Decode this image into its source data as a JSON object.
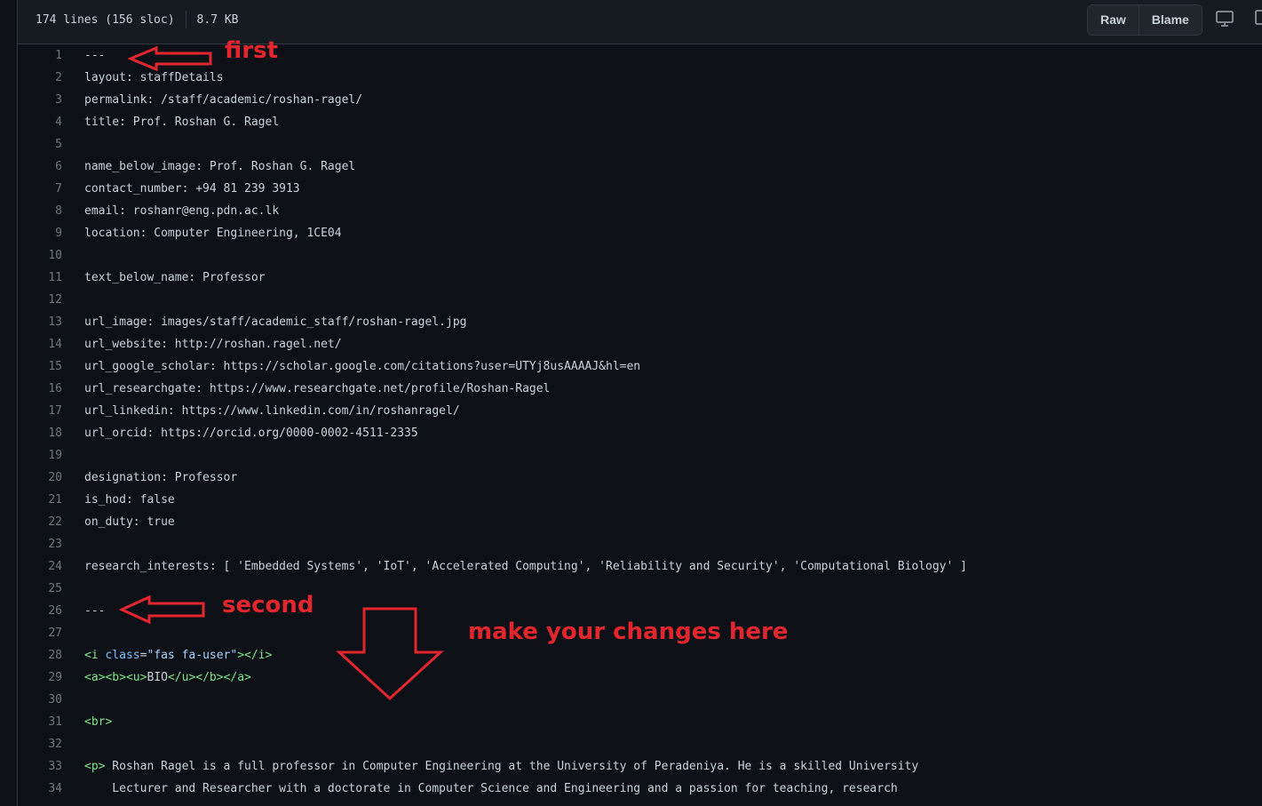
{
  "header": {
    "lines_info": "174 lines (156 sloc)",
    "size_info": "8.7 KB",
    "raw_label": "Raw",
    "blame_label": "Blame",
    "display_icon": "monitor-icon",
    "copy_icon": "copy-icon"
  },
  "colors": {
    "annotation": "#e3262d",
    "background": "#0d1117",
    "text": "#c9d1d9"
  },
  "code": {
    "lines": [
      {
        "n": "1",
        "t": "---"
      },
      {
        "n": "2",
        "t": "layout: staffDetails"
      },
      {
        "n": "3",
        "t": "permalink: /staff/academic/roshan-ragel/"
      },
      {
        "n": "4",
        "t": "title: Prof. Roshan G. Ragel"
      },
      {
        "n": "5",
        "t": ""
      },
      {
        "n": "6",
        "t": "name_below_image: Prof. Roshan G. Ragel"
      },
      {
        "n": "7",
        "t": "contact_number: +94 81 239 3913"
      },
      {
        "n": "8",
        "t": "email: roshanr@eng.pdn.ac.lk"
      },
      {
        "n": "9",
        "t": "location: Computer Engineering, 1CE04"
      },
      {
        "n": "10",
        "t": ""
      },
      {
        "n": "11",
        "t": "text_below_name: Professor"
      },
      {
        "n": "12",
        "t": ""
      },
      {
        "n": "13",
        "t": "url_image: images/staff/academic_staff/roshan-ragel.jpg"
      },
      {
        "n": "14",
        "t": "url_website: http://roshan.ragel.net/"
      },
      {
        "n": "15",
        "t": "url_google_scholar: https://scholar.google.com/citations?user=UTYj8usAAAAJ&hl=en"
      },
      {
        "n": "16",
        "t": "url_researchgate: https://www.researchgate.net/profile/Roshan-Ragel"
      },
      {
        "n": "17",
        "t": "url_linkedin: https://www.linkedin.com/in/roshanragel/"
      },
      {
        "n": "18",
        "t": "url_orcid: https://orcid.org/0000-0002-4511-2335"
      },
      {
        "n": "19",
        "t": ""
      },
      {
        "n": "20",
        "t": "designation: Professor"
      },
      {
        "n": "21",
        "t": "is_hod: false"
      },
      {
        "n": "22",
        "t": "on_duty: true"
      },
      {
        "n": "23",
        "t": ""
      },
      {
        "n": "24",
        "t": "research_interests: [ 'Embedded Systems', 'IoT', 'Accelerated Computing', 'Reliability and Security', 'Computational Biology' ]"
      },
      {
        "n": "25",
        "t": ""
      },
      {
        "n": "26",
        "t": "---"
      },
      {
        "n": "27",
        "t": ""
      },
      {
        "n": "28",
        "t": "<i class=\"fas fa-user\"></i>"
      },
      {
        "n": "29",
        "t": "<a><b><u>BIO</u></b></a>"
      },
      {
        "n": "30",
        "t": ""
      },
      {
        "n": "31",
        "t": "<br>"
      },
      {
        "n": "32",
        "t": ""
      },
      {
        "n": "33",
        "t": "<p> Roshan Ragel is a full professor in Computer Engineering at the University of Peradeniya. He is a skilled University"
      },
      {
        "n": "34",
        "t": "    Lecturer and Researcher with a doctorate in Computer Science and Engineering and a passion for teaching, research"
      }
    ]
  },
  "annotations": {
    "first": "first",
    "second": "second",
    "changes": "make your changes here"
  }
}
